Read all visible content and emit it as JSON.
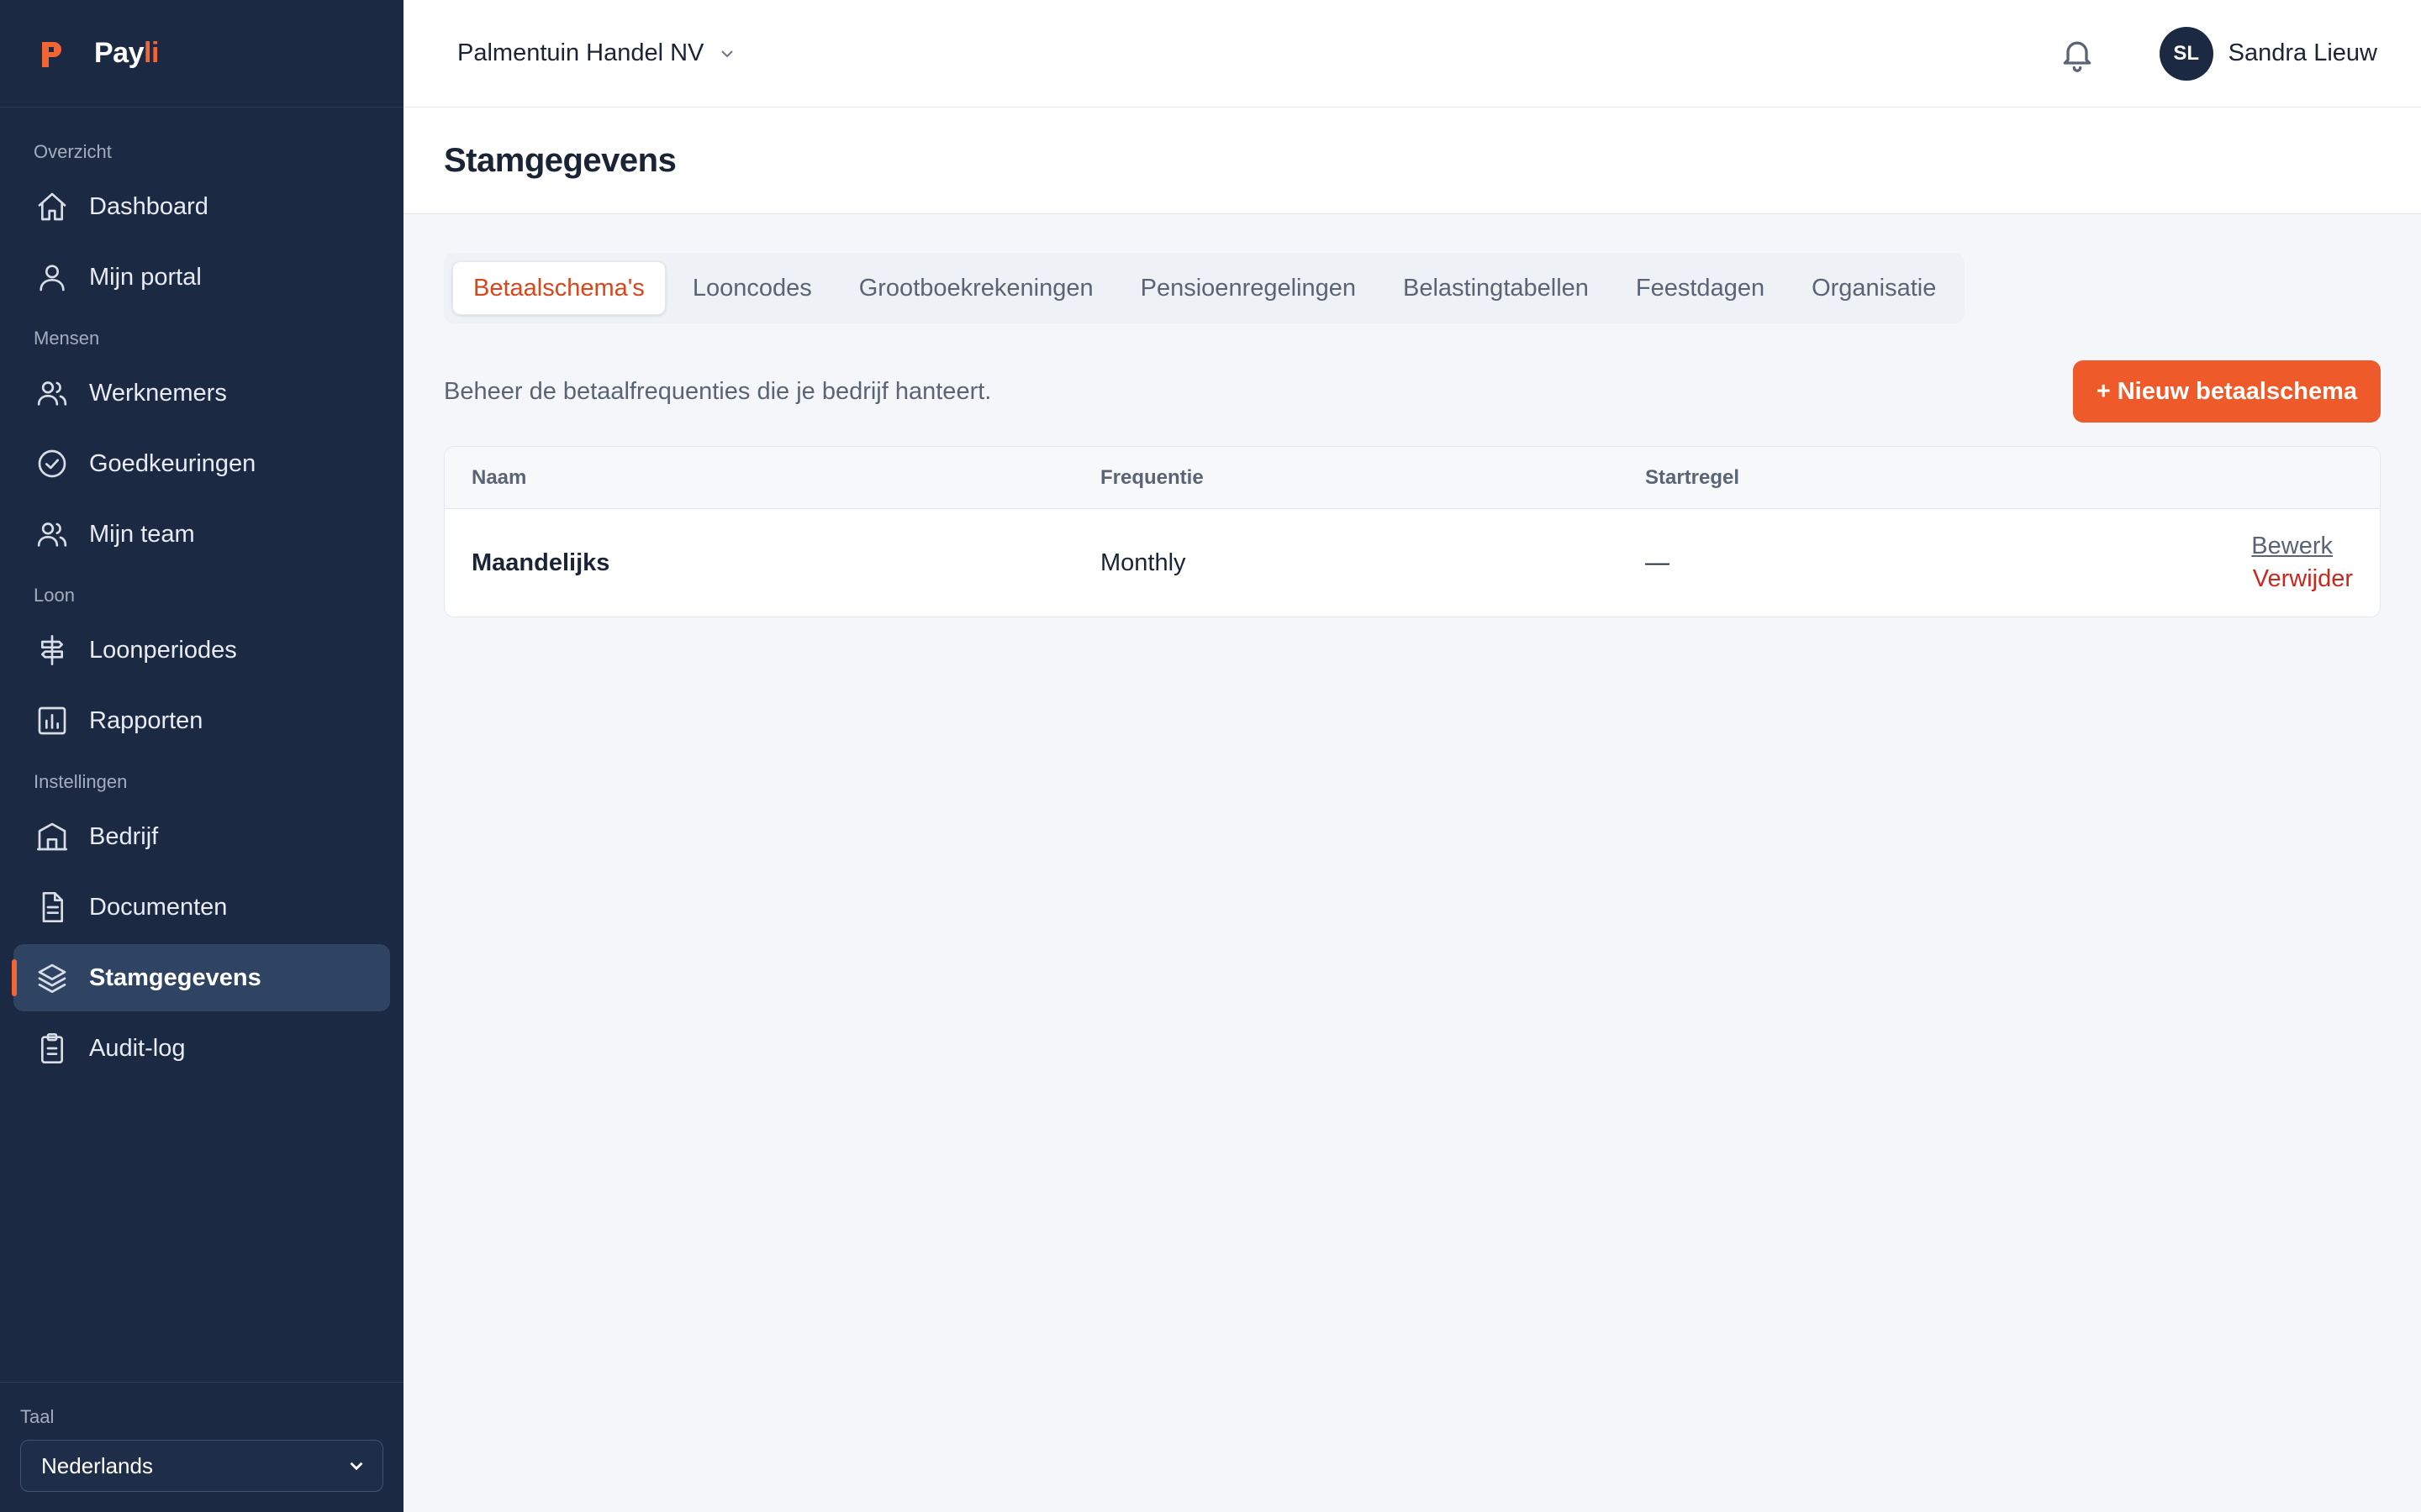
{
  "brand": {
    "name_main": "Pay",
    "name_accent": "li"
  },
  "sidebar": {
    "sections": [
      {
        "label": "Overzicht",
        "items": [
          {
            "label": "Dashboard",
            "icon": "home-icon"
          },
          {
            "label": "Mijn portal",
            "icon": "user-icon"
          }
        ]
      },
      {
        "label": "Mensen",
        "items": [
          {
            "label": "Werknemers",
            "icon": "users-icon"
          },
          {
            "label": "Goedkeuringen",
            "icon": "check-circle-icon"
          },
          {
            "label": "Mijn team",
            "icon": "team-icon"
          }
        ]
      },
      {
        "label": "Loon",
        "items": [
          {
            "label": "Loonperiodes",
            "icon": "signpost-icon"
          },
          {
            "label": "Rapporten",
            "icon": "bar-chart-icon"
          }
        ]
      },
      {
        "label": "Instellingen",
        "items": [
          {
            "label": "Bedrijf",
            "icon": "building-icon"
          },
          {
            "label": "Documenten",
            "icon": "document-icon"
          },
          {
            "label": "Stamgegevens",
            "icon": "layers-icon",
            "active": true
          },
          {
            "label": "Audit-log",
            "icon": "clipboard-icon"
          }
        ]
      }
    ],
    "language": {
      "label": "Taal",
      "value": "Nederlands"
    }
  },
  "topbar": {
    "company": "Palmentuin Handel NV",
    "user": {
      "initials": "SL",
      "name": "Sandra Lieuw"
    }
  },
  "page": {
    "title": "Stamgegevens"
  },
  "tabs": [
    {
      "label": "Betaalschema's",
      "active": true
    },
    {
      "label": "Looncodes"
    },
    {
      "label": "Grootboekrekeningen"
    },
    {
      "label": "Pensioenregelingen"
    },
    {
      "label": "Belastingtabellen"
    },
    {
      "label": "Feestdagen"
    },
    {
      "label": "Organisatie"
    }
  ],
  "toolbar": {
    "description": "Beheer de betaalfrequenties die je bedrijf hanteert.",
    "new_button": "+ Nieuw betaalschema"
  },
  "table": {
    "columns": [
      "Naam",
      "Frequentie",
      "Startregel"
    ],
    "rows": [
      {
        "name": "Maandelijks",
        "frequency": "Monthly",
        "start_rule": "—",
        "edit": "Bewerk",
        "delete": "Verwijder"
      }
    ]
  },
  "colors": {
    "accent": "#ef5a2a",
    "sidebar": "#1b2942",
    "danger": "#c8281e"
  }
}
